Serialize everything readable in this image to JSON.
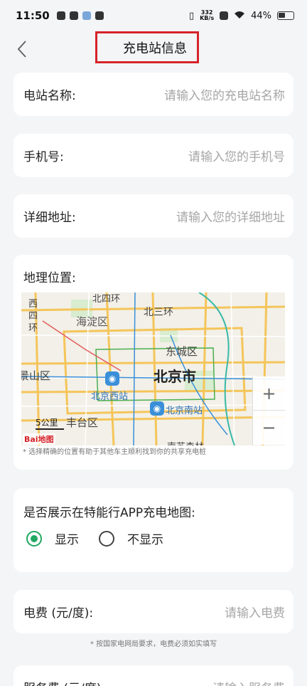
{
  "status_bar": {
    "time": "11:50",
    "speed_value": "332",
    "speed_unit": "KB/s",
    "battery": "44%"
  },
  "header": {
    "title": "充电站信息"
  },
  "fields": {
    "station_name": {
      "label": "电站名称:",
      "placeholder": "请输入您的充电站名称"
    },
    "phone": {
      "label": "手机号:",
      "placeholder": "请输入您的手机号"
    },
    "address": {
      "label": "详细地址:",
      "placeholder": "请输入您的详细地址"
    }
  },
  "map": {
    "label": "地理位置:",
    "hint": "* 选择精确的位置有助于其他车主顺利找到你的共享充电桩",
    "places": {
      "beisihuan": "北四环",
      "xisihuan_1": "西",
      "xisihuan_2": "四",
      "xisihuan_3": "环",
      "haidian": "海淀区",
      "beisanhuan": "北三环",
      "dongcheng": "东城区",
      "jingshan": "景山区",
      "beijing": "北京市",
      "beijingxi": "北京西站",
      "beijingnan": "北京南站",
      "fengtai": "丰台区",
      "nansanhuan": "南苏森林"
    },
    "scale": "5公里",
    "zoom_in": "+",
    "zoom_out": "−",
    "logo": "Bai地图"
  },
  "display": {
    "label": "是否展示在特能行APP充电地图:",
    "options": [
      {
        "label": "显示",
        "checked": true
      },
      {
        "label": "不显示",
        "checked": false
      }
    ]
  },
  "fee": {
    "label": "电费 (元/度):",
    "placeholder": "请输入电费",
    "hint": "* 按国家电网局要求，电费必须如实填写"
  },
  "service_fee": {
    "label": "服务费 (元/度):",
    "placeholder": "请输入服务费"
  },
  "colors": {
    "accent": "#22a862",
    "highlight": "#d6232b"
  }
}
